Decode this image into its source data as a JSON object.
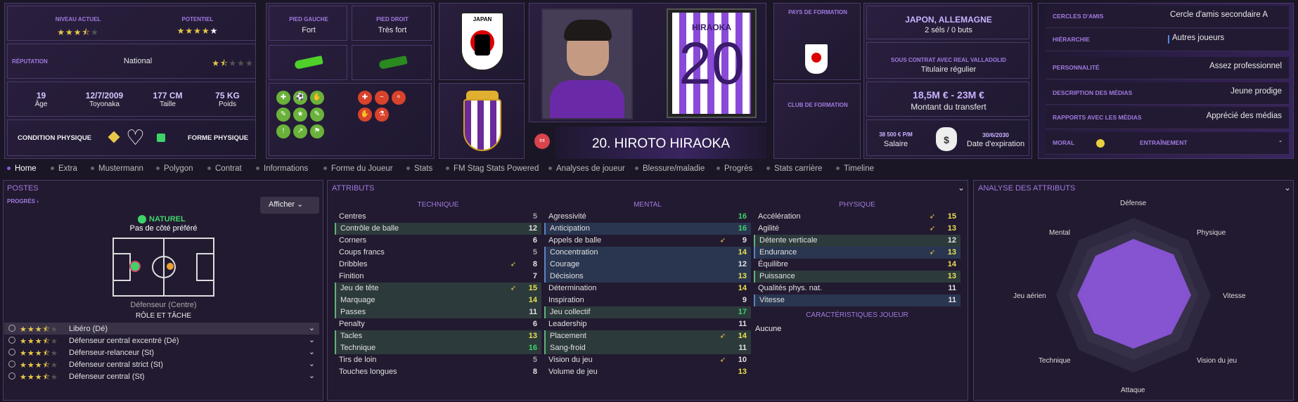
{
  "ratings": {
    "current_label": "NIVEAU ACTUEL",
    "potential_label": "POTENTIEL",
    "current_stars": 3.5,
    "potential_stars": 4.5
  },
  "reputation": {
    "label": "RÉPUTATION",
    "value": "National",
    "stars": 1.5
  },
  "bio": [
    {
      "value": "19",
      "label": "Âge"
    },
    {
      "value": "12/7/2009",
      "label": "Toyonaka"
    },
    {
      "value": "177 CM",
      "label": "Taille"
    },
    {
      "value": "75 KG",
      "label": "Poids"
    }
  ],
  "condition": {
    "label": "CONDITION PHYSIQUE",
    "form_label": "FORME PHYSIQUE"
  },
  "feet": {
    "left_label": "PIED GAUCHE",
    "left_value": "Fort",
    "right_label": "PIED DROIT",
    "right_value": "Très fort"
  },
  "player": {
    "name": "20. HIROTO HIRAOKA",
    "shirt_name": "HIRAOKA",
    "shirt_number": "20",
    "badge": "Int"
  },
  "national_logo_text": "JAPAN",
  "formation": {
    "country_label": "PAYS DE FORMATION",
    "club_label": "CLUB DE FORMATION"
  },
  "international": {
    "countries": "JAPON, ALLEMAGNE",
    "caps": "2 séls / 0 buts"
  },
  "contract": {
    "label": "SOUS CONTRAT AVEC REAL VALLADOLID",
    "status": "Titulaire régulier"
  },
  "transfer": {
    "value": "18,5M € - 23M €",
    "label": "Montant du transfert"
  },
  "salary": {
    "value": "38 500 € P/M",
    "label": "Salaire",
    "expiry": "30/6/2030",
    "expiry_label": "Date d'expiration"
  },
  "side_info": [
    {
      "key": "CERCLES D'AMIS",
      "value": "Cercle d'amis secondaire A"
    },
    {
      "key": "HIÉRARCHIE",
      "value": "Autres joueurs"
    },
    {
      "key": "PERSONNALITÉ",
      "value": "Assez professionnel"
    },
    {
      "key": "DESCRIPTION DES MÉDIAS",
      "value": "Jeune prodige"
    },
    {
      "key": "RAPPORTS AVEC LES MÉDIAS",
      "value": "Apprécié des médias"
    },
    {
      "key": "MORAL",
      "value": "ENTRAÎNEMENT",
      "extra": "-"
    }
  ],
  "tabs": [
    "Home",
    "Extra",
    "Mustermann",
    "Polygon",
    "Contrat",
    "Informations",
    "Forme du Joueur",
    "Stats",
    "FM Stag Stats Powered",
    "Analyses de joueur",
    "Blessure/maladie",
    "Progrès",
    "Stats carrière",
    "Timeline"
  ],
  "positions": {
    "title": "POSTES",
    "progress": "PROGRÈS",
    "show_button": "Afficher",
    "natural": "NATUREL",
    "side": "Pas de côté préféré",
    "position_name": "Défenseur (Centre)",
    "role_title": "RÔLE ET TÂCHE",
    "roles": [
      {
        "name": "Libéro (Dé)",
        "stars": 3.5
      },
      {
        "name": "Défenseur central excentré (Dé)",
        "stars": 3.5
      },
      {
        "name": "Défenseur-relanceur (St)",
        "stars": 3.5
      },
      {
        "name": "Défenseur central strict (St)",
        "stars": 3.5
      },
      {
        "name": "Défenseur central (St)",
        "stars": 3.5
      }
    ]
  },
  "attributes": {
    "title": "ATTRIBUTS",
    "tech_title": "TECHNIQUE",
    "mental_title": "MENTAL",
    "physical_title": "PHYSIQUE",
    "traits_title": "CARACTÉRISTIQUES JOUEUR",
    "traits_value": "Aucune",
    "technical": [
      {
        "name": "Centres",
        "value": 5
      },
      {
        "name": "Contrôle de balle",
        "value": 12,
        "hl": 1
      },
      {
        "name": "Corners",
        "value": 6
      },
      {
        "name": "Coups francs",
        "value": 5
      },
      {
        "name": "Dribbles",
        "value": 8,
        "up": 1
      },
      {
        "name": "Finition",
        "value": 7
      },
      {
        "name": "Jeu de tête",
        "value": 15,
        "hl": 1,
        "up": 1
      },
      {
        "name": "Marquage",
        "value": 14,
        "hl": 1
      },
      {
        "name": "Passes",
        "value": 11,
        "hl": 1
      },
      {
        "name": "Penalty",
        "value": 6
      },
      {
        "name": "Tacles",
        "value": 13,
        "hl": 1
      },
      {
        "name": "Technique",
        "value": 16,
        "hl": 1
      },
      {
        "name": "Tirs de loin",
        "value": 5
      },
      {
        "name": "Touches longues",
        "value": 8
      }
    ],
    "mental": [
      {
        "name": "Agressivité",
        "value": 16
      },
      {
        "name": "Anticipation",
        "value": 16,
        "hl": 2
      },
      {
        "name": "Appels de balle",
        "value": 9,
        "up": 1
      },
      {
        "name": "Concentration",
        "value": 14,
        "hl": 2
      },
      {
        "name": "Courage",
        "value": 12,
        "hl": 2
      },
      {
        "name": "Décisions",
        "value": 13,
        "hl": 2
      },
      {
        "name": "Détermination",
        "value": 14
      },
      {
        "name": "Inspiration",
        "value": 9
      },
      {
        "name": "Jeu collectif",
        "value": 17,
        "hl": 1
      },
      {
        "name": "Leadership",
        "value": 11
      },
      {
        "name": "Placement",
        "value": 14,
        "hl": 1,
        "up": 1
      },
      {
        "name": "Sang-froid",
        "value": 11,
        "hl": 1
      },
      {
        "name": "Vision du jeu",
        "value": 10,
        "up": 1
      },
      {
        "name": "Volume de jeu",
        "value": 13
      }
    ],
    "physical": [
      {
        "name": "Accélération",
        "value": 15,
        "up": 1
      },
      {
        "name": "Agilité",
        "value": 13,
        "up": 1
      },
      {
        "name": "Détente verticale",
        "value": 12,
        "hl": 1
      },
      {
        "name": "Endurance",
        "value": 13,
        "hl": 2,
        "up": 1
      },
      {
        "name": "Équilibre",
        "value": 14
      },
      {
        "name": "Puissance",
        "value": 13,
        "hl": 1
      },
      {
        "name": "Qualités phys. nat.",
        "value": 11
      },
      {
        "name": "Vitesse",
        "value": 11,
        "hl": 2
      }
    ]
  },
  "analysis": {
    "title": "ANALYSE DES ATTRIBUTS",
    "labels": [
      "Défense",
      "Physique",
      "Vitesse",
      "Vision du jeu",
      "Attaque",
      "Technique",
      "Jeu aérien",
      "Mental"
    ]
  },
  "colors": {
    "accent": "#a07ae0",
    "green": "#3ed36a",
    "yellow": "#e8e050",
    "bg": "#1b1626"
  }
}
